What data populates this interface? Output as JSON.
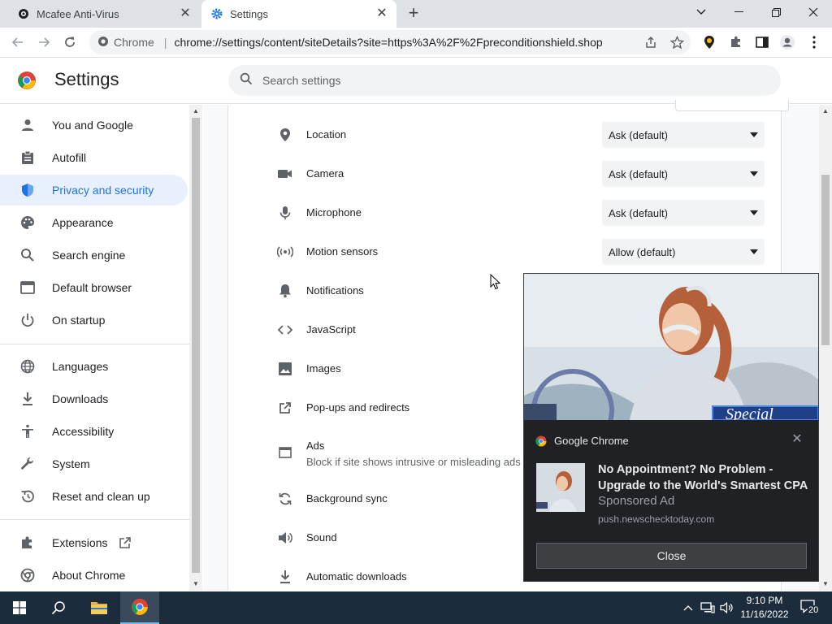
{
  "tabs": [
    {
      "title": "Mcafee Anti-Virus",
      "active": false
    },
    {
      "title": "Settings",
      "active": true
    }
  ],
  "toolbar": {
    "omnibox_chip": "Chrome",
    "url": "chrome://settings/content/siteDetails?site=https%3A%2F%2Fpreconditionshield.shop"
  },
  "settings": {
    "title": "Settings",
    "search_placeholder": "Search settings"
  },
  "sidebar": {
    "items": [
      {
        "label": "You and Google",
        "icon": "person-icon"
      },
      {
        "label": "Autofill",
        "icon": "clipboard-icon"
      },
      {
        "label": "Privacy and security",
        "icon": "shield-icon",
        "selected": true
      },
      {
        "label": "Appearance",
        "icon": "palette-icon"
      },
      {
        "label": "Search engine",
        "icon": "search-icon"
      },
      {
        "label": "Default browser",
        "icon": "browser-icon"
      },
      {
        "label": "On startup",
        "icon": "power-icon"
      },
      {
        "label": "Languages",
        "icon": "globe-icon"
      },
      {
        "label": "Downloads",
        "icon": "download-icon"
      },
      {
        "label": "Accessibility",
        "icon": "accessibility-icon"
      },
      {
        "label": "System",
        "icon": "wrench-icon"
      },
      {
        "label": "Reset and clean up",
        "icon": "restore-icon"
      },
      {
        "label": "Extensions",
        "icon": "puzzle-icon"
      },
      {
        "label": "About Chrome",
        "icon": "chrome-icon"
      }
    ]
  },
  "permissions": [
    {
      "label": "Location",
      "value": "Ask (default)",
      "icon": "location-pin-icon"
    },
    {
      "label": "Camera",
      "value": "Ask (default)",
      "icon": "camera-icon"
    },
    {
      "label": "Microphone",
      "value": "Ask (default)",
      "icon": "microphone-icon"
    },
    {
      "label": "Motion sensors",
      "value": "Allow (default)",
      "icon": "motion-sensor-icon"
    },
    {
      "label": "Notifications",
      "icon": "bell-icon"
    },
    {
      "label": "JavaScript",
      "icon": "code-icon"
    },
    {
      "label": "Images",
      "icon": "image-icon"
    },
    {
      "label": "Pop-ups and redirects",
      "icon": "open-in-new-icon"
    },
    {
      "label": "Ads",
      "sub": "Block if site shows intrusive or misleading ads",
      "icon": "ads-window-icon"
    },
    {
      "label": "Background sync",
      "icon": "sync-icon"
    },
    {
      "label": "Sound",
      "icon": "speaker-icon"
    },
    {
      "label": "Automatic downloads",
      "icon": "download-icon"
    }
  ],
  "notification": {
    "source": "Google Chrome",
    "title": "No Appointment? No Problem - Upgrade to the World's Smartest CPA",
    "subtitle": "Sponsored Ad",
    "domain": "push.newschecktoday.com",
    "image_text": "Special",
    "close_label": "Close"
  },
  "taskbar": {
    "time": "9:10 PM",
    "date": "11/16/2022",
    "notification_count": "20"
  },
  "colors": {
    "accent": "#1a73e8",
    "selected_bg": "#e8f0fe",
    "notification_bg": "#202124",
    "taskbar_bg": "#1c2c3c"
  }
}
